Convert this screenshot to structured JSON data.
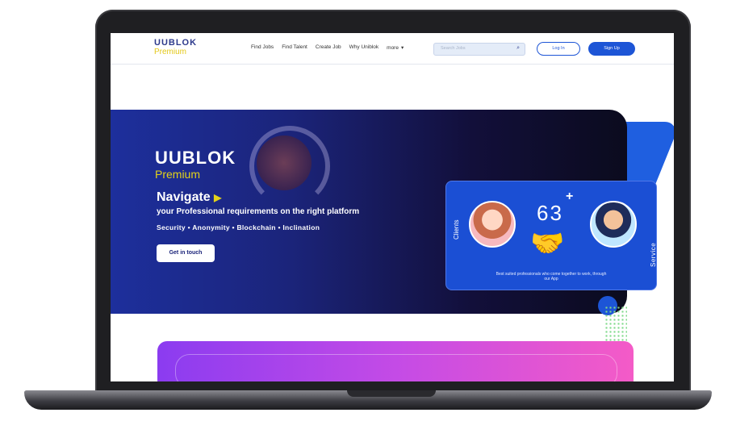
{
  "nav": {
    "logo_main": "UUBLOK",
    "logo_sub": "Premium",
    "links": [
      "Find Jobs",
      "Find Talent",
      "Create Job",
      "Why Uniblok"
    ],
    "more_label": "more",
    "search_placeholder": "Search Jobs",
    "login_label": "Log In",
    "signup_label": "Sign Up"
  },
  "hero": {
    "logo_main": "UUBLOK",
    "logo_sub": "Premium",
    "title": "Navigate",
    "subtitle": "your Professional requirements on the right platform",
    "tags": "Security • Anonymity • Blockchain • Inclination",
    "cta_label": "Get in touch"
  },
  "card": {
    "left_label": "Clients",
    "right_label": "Service providers",
    "count": "63",
    "plus": "+",
    "caption": "Best suited professionals who come together to work, through our App"
  },
  "colors": {
    "brand_blue": "#1d55d6",
    "brand_yellow": "#e3d21a",
    "hero_dark": "#1b247a"
  },
  "icons": {
    "search": "search-icon",
    "chevron": "chevron-down-icon",
    "handshake": "handshake-icon"
  }
}
